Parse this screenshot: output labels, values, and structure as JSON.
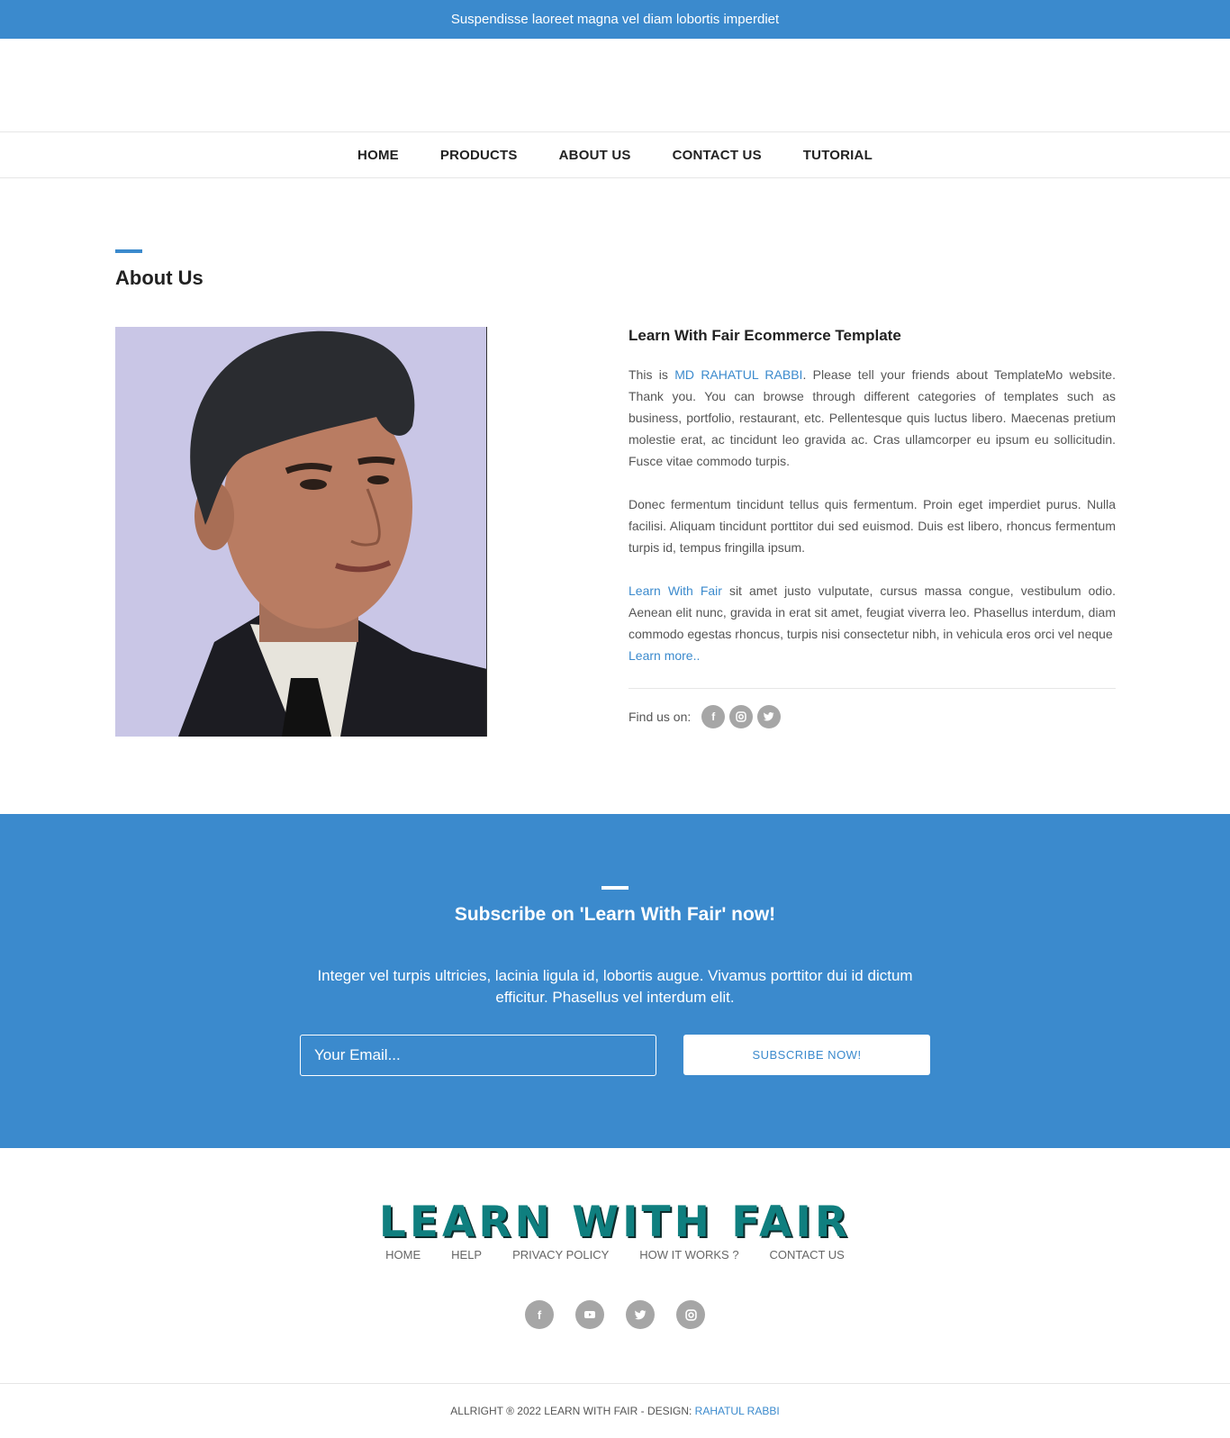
{
  "topbar": {
    "text": "Suspendisse laoreet magna vel diam lobortis imperdiet"
  },
  "nav": {
    "items": [
      "HOME",
      "PRODUCTS",
      "ABOUT US",
      "CONTACT US",
      "TUTORIAL"
    ]
  },
  "about": {
    "title": "About Us",
    "heading": "Learn With Fair Ecommerce Template",
    "p1_prefix": "This is ",
    "p1_link": "MD RAHATUL RABBI",
    "p1_rest": ". Please tell your friends about TemplateMo website. Thank you. You can browse through different categories of templates such as business, portfolio, restaurant, etc. Pellentesque quis luctus libero. Maecenas pretium molestie erat, ac tincidunt leo gravida ac. Cras ullamcorper eu ipsum eu sollicitudin. Fusce vitae commodo turpis.",
    "p2": "Donec fermentum tincidunt tellus quis fermentum. Proin eget imperdiet purus. Nulla facilisi. Aliquam tincidunt porttitor dui sed euismod. Duis est libero, rhoncus fermentum turpis id, tempus fringilla ipsum.",
    "p3_link": "Learn With Fair",
    "p3_rest": " sit amet justo vulputate, cursus massa congue, vestibulum odio. Aenean elit nunc, gravida in erat sit amet, feugiat viverra leo. Phasellus interdum, diam commodo egestas rhoncus, turpis nisi consectetur nibh, in vehicula eros orci vel neque",
    "learn_more": "Learn more..",
    "find_us": "Find us on:",
    "social_icons": [
      "facebook-icon",
      "instagram-icon",
      "twitter-icon"
    ]
  },
  "subscribe": {
    "title": "Subscribe on 'Learn With Fair' now!",
    "text": "Integer vel turpis ultricies, lacinia ligula id, lobortis augue. Vivamus porttitor dui id dictum efficitur. Phasellus vel interdum elit.",
    "email_placeholder": "Your Email...",
    "button_label": "SUBSCRIBE NOW!"
  },
  "footer": {
    "logo": "LEARN WITH FAIR",
    "links": [
      "HOME",
      "HELP",
      "PRIVACY POLICY",
      "HOW IT WORKS ?",
      "CONTACT US"
    ],
    "social_icons": [
      "facebook-icon",
      "youtube-icon",
      "twitter-icon",
      "instagram-icon"
    ],
    "copyright_prefix": "ALLRIGHT ® 2022 LEARN WITH FAIR - DESIGN: ",
    "copyright_link": "RAHATUL RABBI"
  },
  "colors": {
    "accent": "#3b8acd",
    "logo": "#0f7f7f",
    "icon_gray": "#a6a6a6"
  }
}
